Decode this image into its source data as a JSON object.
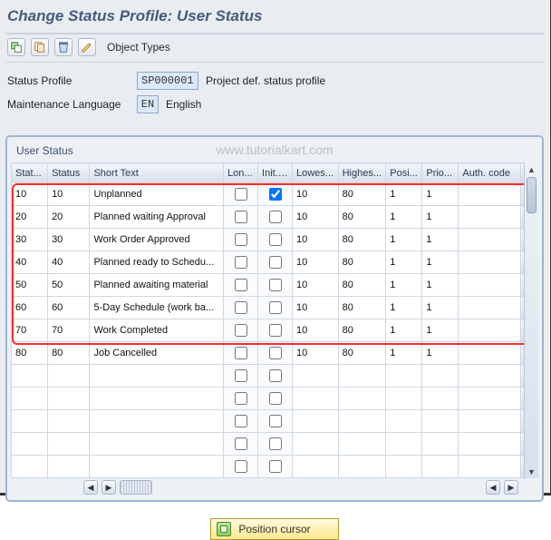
{
  "title": "Change Status Profile: User Status",
  "toolbar": {
    "object_types_label": "Object Types"
  },
  "header": {
    "profile_label": "Status Profile",
    "profile_value": "SP000001",
    "profile_desc": "Project def. status profile",
    "lang_label": "Maintenance Language",
    "lang_value": "EN",
    "lang_desc": "English"
  },
  "groupbox_title": "User Status",
  "watermark": "www.tutorialkart.com",
  "columns": {
    "statnr": "Stat...",
    "status": "Status",
    "short_text": "Short Text",
    "long": "Lon...",
    "init": "Init. ...",
    "lowest": "Lowes...",
    "highest": "Highes...",
    "position": "Posi...",
    "priority": "Prio...",
    "auth": "Auth. code"
  },
  "rows": [
    {
      "statnr": "10",
      "status": "10",
      "short": "Unplanned",
      "long": false,
      "init": true,
      "lowest": "10",
      "highest": "80",
      "pos": "1",
      "prio": "1",
      "auth": ""
    },
    {
      "statnr": "20",
      "status": "20",
      "short": "Planned waiting Approval",
      "long": false,
      "init": false,
      "lowest": "10",
      "highest": "80",
      "pos": "1",
      "prio": "1",
      "auth": ""
    },
    {
      "statnr": "30",
      "status": "30",
      "short": "Work Order Approved",
      "long": false,
      "init": false,
      "lowest": "10",
      "highest": "80",
      "pos": "1",
      "prio": "1",
      "auth": ""
    },
    {
      "statnr": "40",
      "status": "40",
      "short": "Planned ready to Schedu...",
      "long": false,
      "init": false,
      "lowest": "10",
      "highest": "80",
      "pos": "1",
      "prio": "1",
      "auth": ""
    },
    {
      "statnr": "50",
      "status": "50",
      "short": "Planned awaiting material",
      "long": false,
      "init": false,
      "lowest": "10",
      "highest": "80",
      "pos": "1",
      "prio": "1",
      "auth": ""
    },
    {
      "statnr": "60",
      "status": "60",
      "short": "5-Day Schedule (work ba...",
      "long": false,
      "init": false,
      "lowest": "10",
      "highest": "80",
      "pos": "1",
      "prio": "1",
      "auth": ""
    },
    {
      "statnr": "70",
      "status": "70",
      "short": "Work Completed",
      "long": false,
      "init": false,
      "lowest": "10",
      "highest": "80",
      "pos": "1",
      "prio": "1",
      "auth": ""
    },
    {
      "statnr": "80",
      "status": "80",
      "short": "Job Cancelled",
      "long": false,
      "init": false,
      "lowest": "10",
      "highest": "80",
      "pos": "1",
      "prio": "1",
      "auth": ""
    }
  ],
  "blank_rows": 5,
  "position_cursor_label": "Position cursor"
}
